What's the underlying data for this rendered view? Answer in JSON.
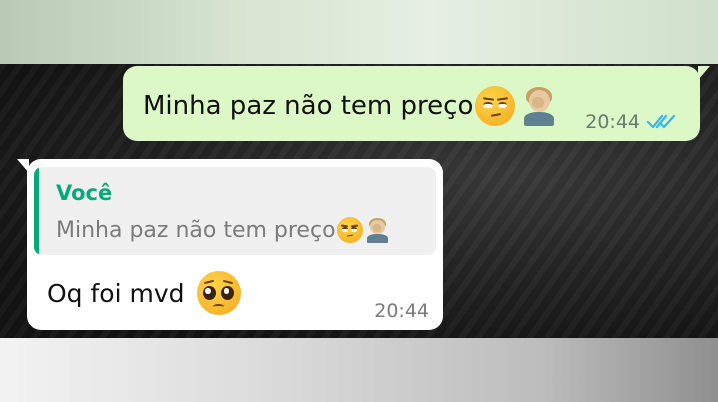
{
  "outgoing": {
    "text": "Minha paz não tem preço",
    "emojis": [
      "unamused-face-icon",
      "facepalm-icon"
    ],
    "time": "20:44",
    "status": "read",
    "tick_color": "#34b7f1"
  },
  "incoming": {
    "quote_author": "Você",
    "quote_text": "Minha paz não tem preço",
    "quote_emojis": [
      "unamused-face-icon",
      "facepalm-icon"
    ],
    "text": "Oq foi mvd",
    "emojis": [
      "pleading-face-icon"
    ],
    "time": "20:44"
  },
  "colors": {
    "outgoing_bubble": "#dcf8c6",
    "incoming_bubble": "#ffffff",
    "accent": "#06a97c"
  }
}
